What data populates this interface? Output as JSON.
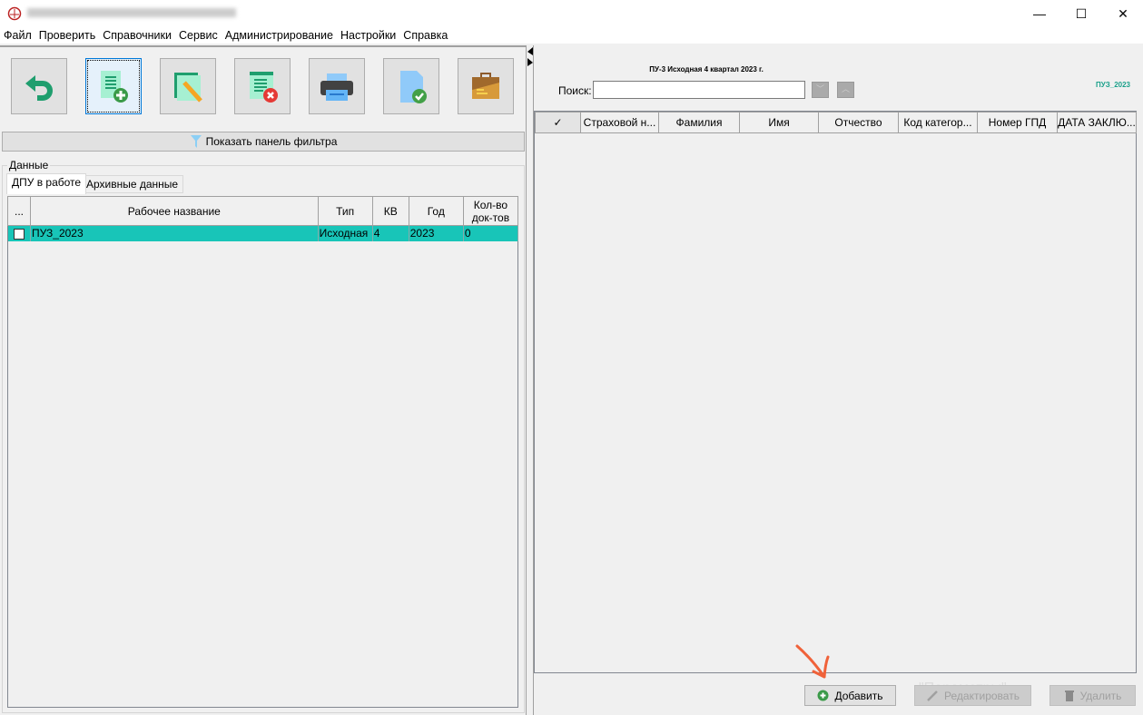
{
  "window": {
    "controls": {
      "minimize": "—",
      "maximize": "☐",
      "close": "✕"
    }
  },
  "menu": [
    "Файл",
    "Проверить",
    "Справочники",
    "Сервис",
    "Администрирование",
    "Настройки",
    "Справка"
  ],
  "toolbar": {
    "icons": [
      "undo-icon",
      "add-document-icon",
      "edit-document-icon",
      "delete-document-icon",
      "printer-icon",
      "document-check-icon",
      "briefcase-icon"
    ]
  },
  "filter_button": "Показать панель фильтра",
  "group_label": "Данные",
  "tabs": [
    "ДПУ в работе",
    "Архивные данные"
  ],
  "left_table": {
    "columns": [
      "...",
      "Рабочее название",
      "Тип",
      "КВ",
      "Год",
      "Кол-во док-тов"
    ],
    "rows": [
      {
        "name": "ПУЗ_2023",
        "type": "Исходная",
        "kv": "4",
        "year": "2023",
        "count": "0"
      }
    ],
    "selected_color": "#18c5b8"
  },
  "right": {
    "title": "ПУ-3 Исходная 4 квартал 2023 г.",
    "search_label": "Поиск:",
    "search_value": "",
    "package_name": "ПУЗ_2023",
    "columns": [
      "✓",
      "Страховой н...",
      "Фамилия",
      "Имя",
      "Отчество",
      "Код категор...",
      "Номер ГПД",
      "ДАТА ЗАКЛЮ..."
    ],
    "ghost_text": "\"Параметры\"",
    "buttons": {
      "add": "Добавить",
      "edit": "Редактировать",
      "delete": "Удалить"
    }
  }
}
